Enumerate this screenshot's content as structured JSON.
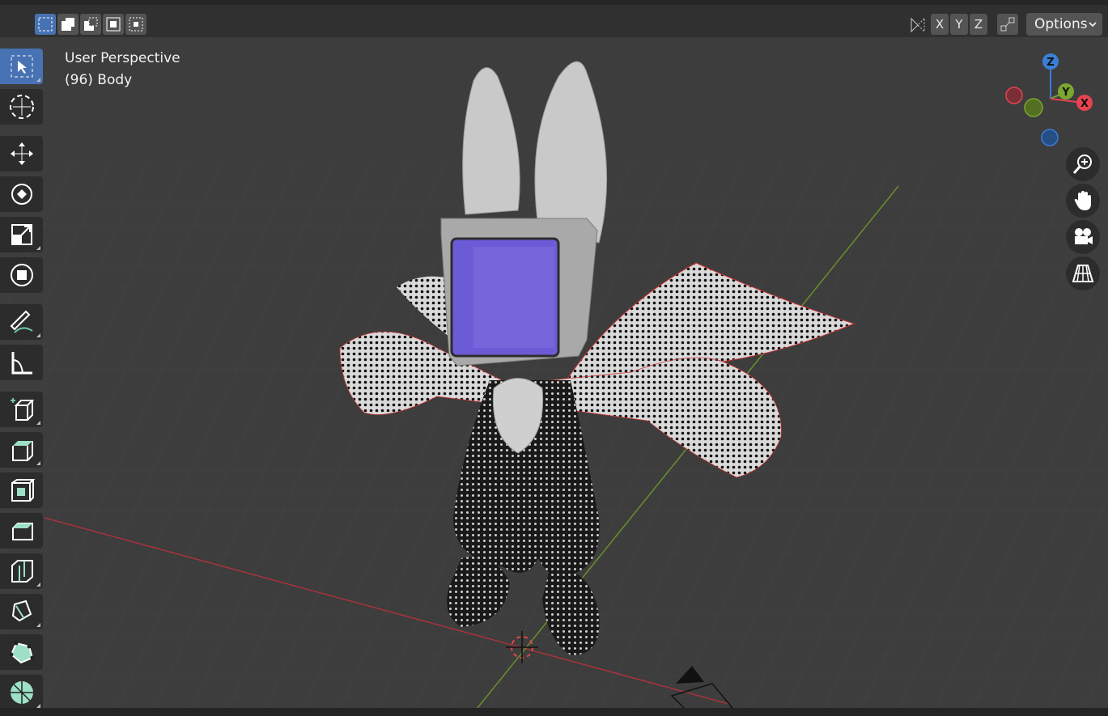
{
  "viewport": {
    "view_name": "User Perspective",
    "object_label": "(96) Body"
  },
  "header": {
    "axis_buttons": [
      "X",
      "Y",
      "Z"
    ],
    "options_label": "Options"
  },
  "gizmo": {
    "z_label": "Z",
    "y_label": "Y",
    "x_label": "X"
  },
  "toolbar": {
    "tools": [
      "select-box",
      "cursor",
      "move",
      "rotate",
      "scale",
      "transform",
      "annotate",
      "measure",
      "add-cube",
      "extrude",
      "inset",
      "bevel",
      "loop-cut",
      "knife",
      "poly-build",
      "spin"
    ]
  },
  "colors": {
    "accent": "#4772b3",
    "x_axis": "#e5444f",
    "y_axis": "#7ba630",
    "z_axis": "#3b7fd4",
    "screen": "#6b5bd6"
  }
}
